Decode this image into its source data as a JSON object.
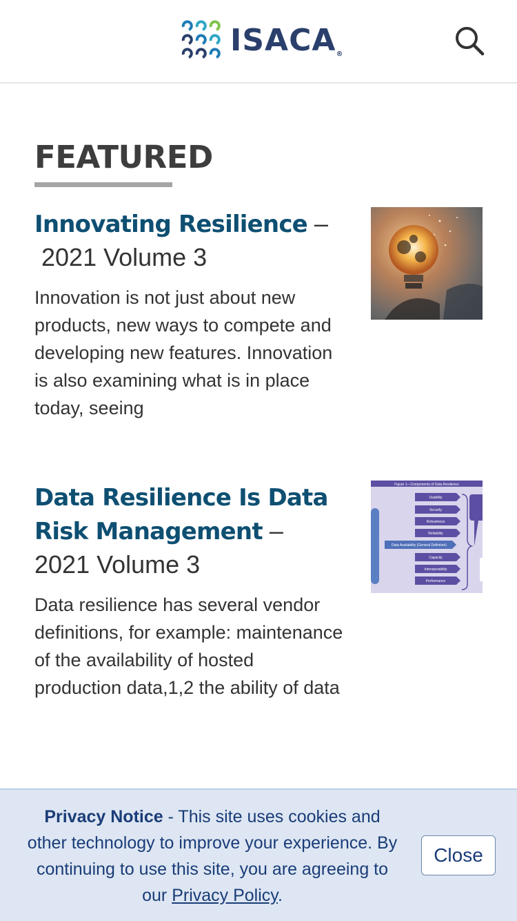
{
  "header": {
    "logo_text": "ISACA",
    "logo_reg": "®",
    "search_icon": "search-icon"
  },
  "featured": {
    "title": "FEATURED",
    "articles": [
      {
        "title": "Innovating Resilience",
        "separator": "–",
        "issue": " 2021 Volume 3",
        "summary": "Innovation is not just about new products, new ways to compete and developing new features. Innovation is also examining what is in place today, seeing",
        "image": "lightbulb-gears-photo"
      },
      {
        "title": "Data Resilience Is Data Risk Management",
        "separator": "–",
        "issue": "2021 Volume 3",
        "summary": "Data resilience has several vendor definitions, for example: maintenance of the availability of hosted production data,1,2 the ability of data",
        "image": "data-resilience-diagram",
        "diagram": {
          "caption": "Figure 1—Components of Data Resilience",
          "center_label": "Data Availability (General Definition)",
          "components": [
            "Usability",
            "Security",
            "Robustness",
            "Reliability",
            "Capacity",
            "Interoperability",
            "Performance"
          ]
        }
      }
    ]
  },
  "privacy": {
    "heading": "Privacy Notice",
    "body": " - This site uses cookies and other technology to improve your experience. By continuing to use this site, you are agreeing to our ",
    "link": "Privacy Policy",
    "end": ".",
    "close_label": "Close"
  },
  "colors": {
    "brand_navy": "#2a3f6b",
    "title_blue": "#0e4f72",
    "banner_bg": "#dde6f2",
    "banner_text": "#1a3c78"
  }
}
